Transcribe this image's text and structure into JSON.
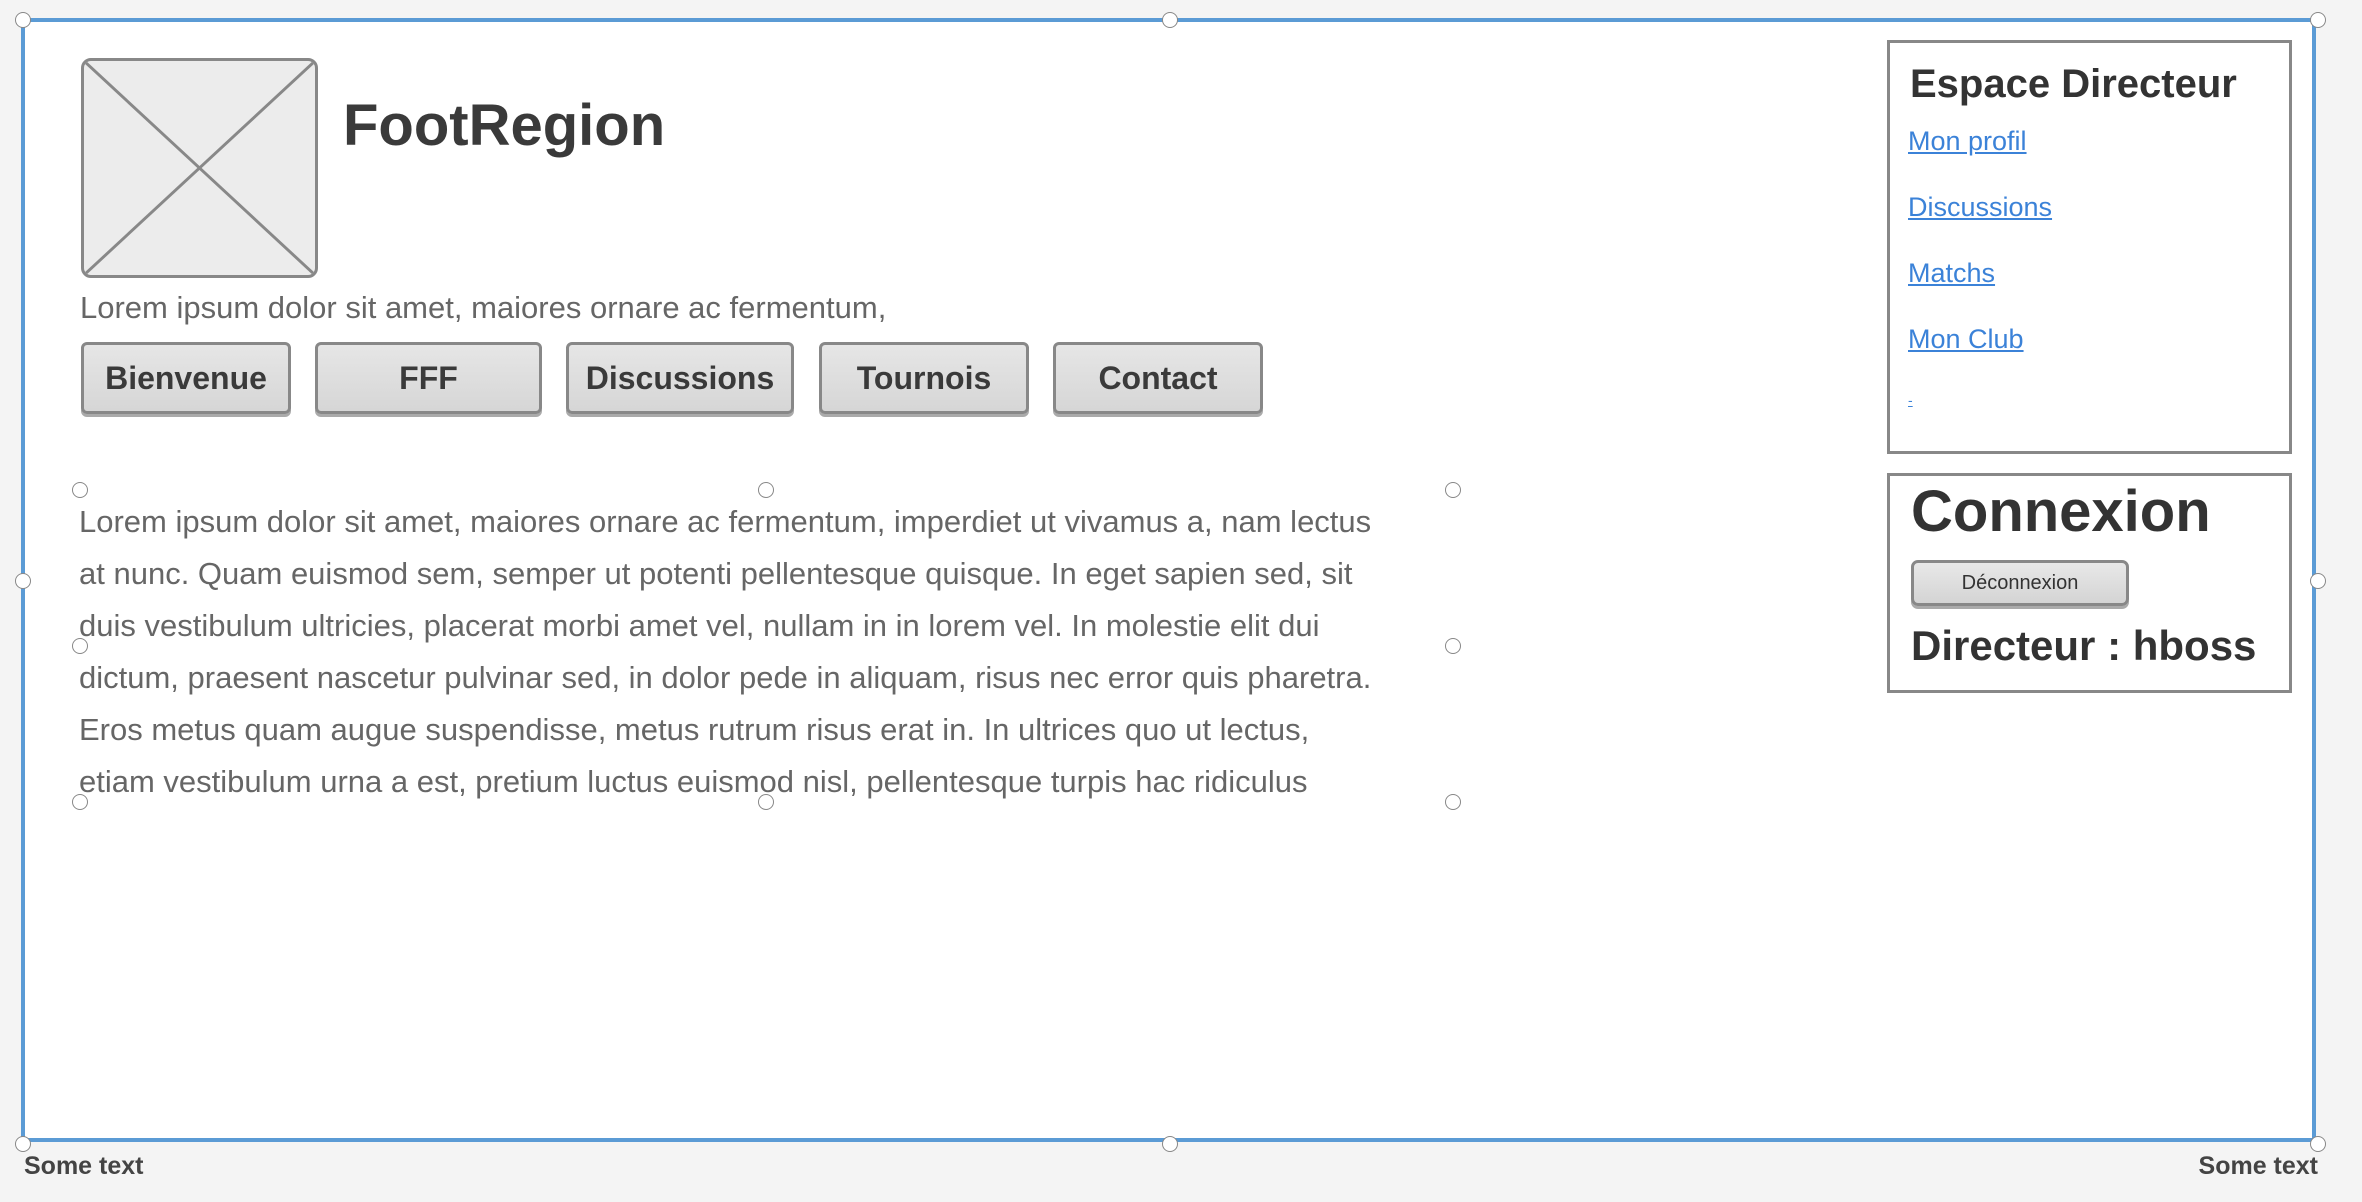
{
  "header": {
    "logo_icon": "image-placeholder-icon",
    "title": "FootRegion",
    "tagline": "Lorem ipsum dolor sit amet, maiores ornare ac fermentum,"
  },
  "nav": {
    "items": [
      {
        "label": "Bienvenue"
      },
      {
        "label": "FFF"
      },
      {
        "label": "Discussions"
      },
      {
        "label": "Tournois"
      },
      {
        "label": "Contact"
      }
    ]
  },
  "main": {
    "lines": [
      "Lorem ipsum dolor sit amet, maiores ornare ac fermentum, imperdiet ut vivamus a, nam lectus",
      "at nunc. Quam euismod sem, semper ut potenti pellentesque quisque. In eget sapien sed, sit",
      "duis vestibulum ultricies, placerat morbi amet vel, nullam in in lorem vel. In molestie elit dui",
      "dictum, praesent nascetur pulvinar sed, in dolor pede in aliquam, risus nec error quis pharetra.",
      "Eros metus quam augue suspendisse, metus rutrum risus erat in.  In ultrices quo ut lectus,",
      "etiam vestibulum urna a est, pretium luctus euismod nisl, pellentesque turpis hac ridiculus"
    ]
  },
  "sidebar": {
    "title": "Espace Directeur",
    "links": [
      {
        "label": "Mon profil"
      },
      {
        "label": "Discussions"
      },
      {
        "label": "Matchs"
      },
      {
        "label": "Mon Club"
      },
      {
        "label": "-"
      }
    ]
  },
  "login": {
    "title": "Connexion",
    "logout_label": "Déconnexion",
    "user_line": "Directeur : hboss"
  },
  "footer": {
    "left": "Some text",
    "right": "Some text"
  },
  "colors": {
    "selection": "#5b9bd5",
    "link": "#3b82d8",
    "border": "#888888"
  }
}
